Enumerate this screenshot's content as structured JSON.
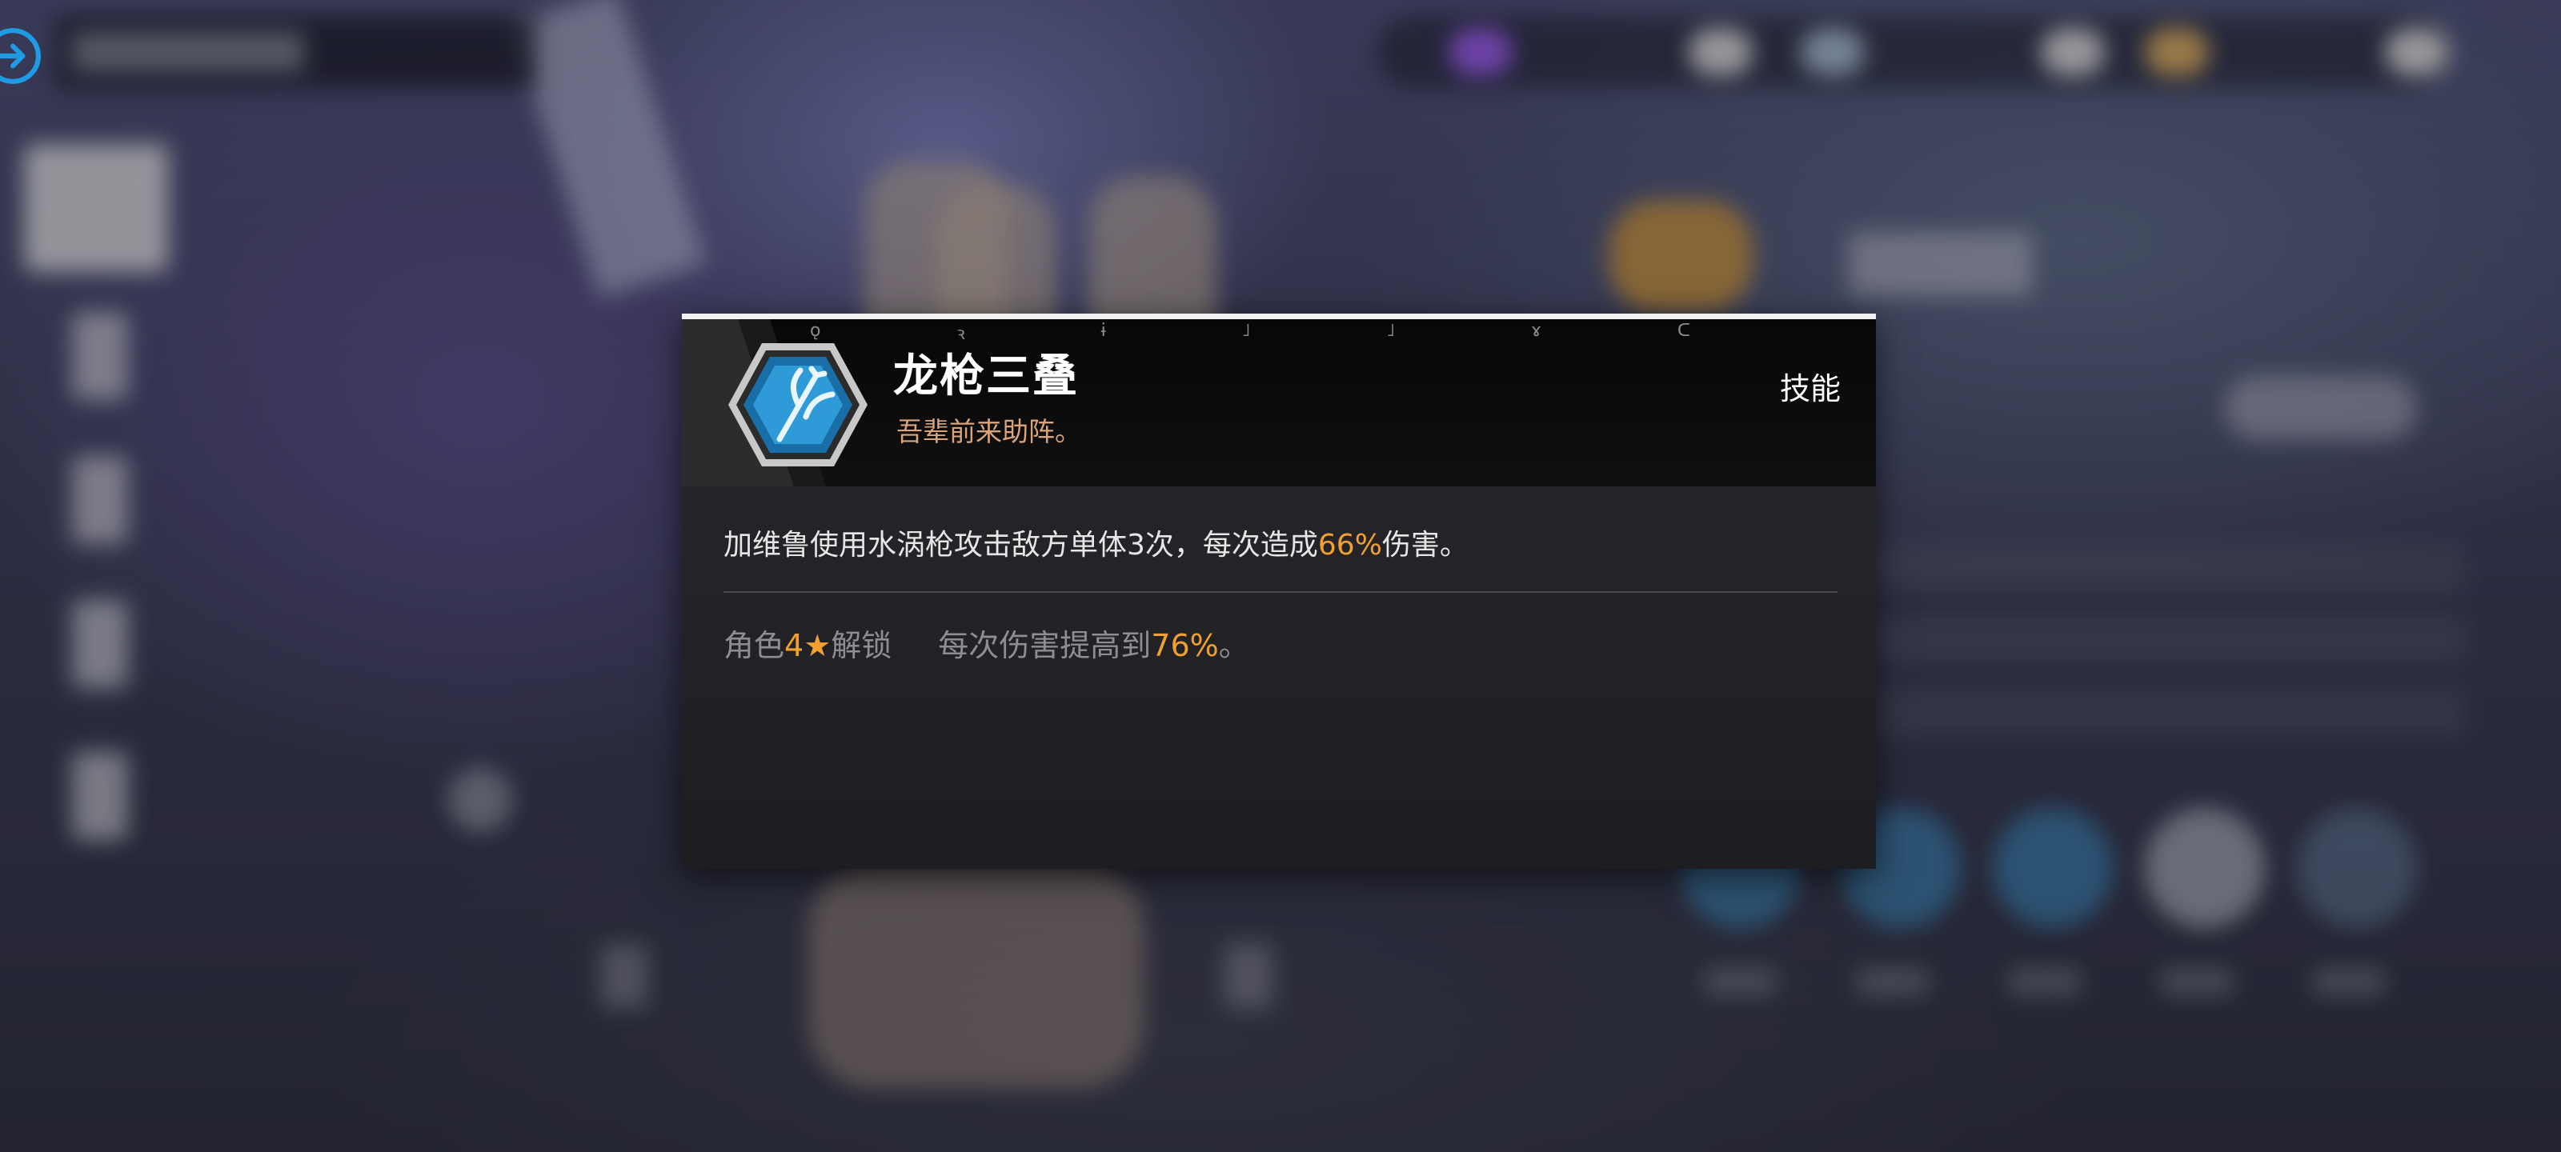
{
  "background": {
    "note_colors": {
      "accent_blue": "#1e9be3",
      "highlight_orange": "#f0a030",
      "quote_color": "#d9a47a"
    }
  },
  "back_button": {
    "icon": "arrow-right-circle-icon"
  },
  "skill_popup": {
    "name": "龙枪三叠",
    "quote": "吾辈前来助阵。",
    "type_label": "技能",
    "icon": "trident-icon",
    "description": {
      "before": "加维鲁使用水涡枪攻击敌方单体3次，每次造成",
      "value": "66%",
      "after": "伤害。"
    },
    "upgrade": {
      "cond_prefix": "角色",
      "cond_star": "4★",
      "cond_suffix": "解锁",
      "effect_before": "每次伤害提高到",
      "effect_value": "76%",
      "effect_after": "。"
    }
  }
}
